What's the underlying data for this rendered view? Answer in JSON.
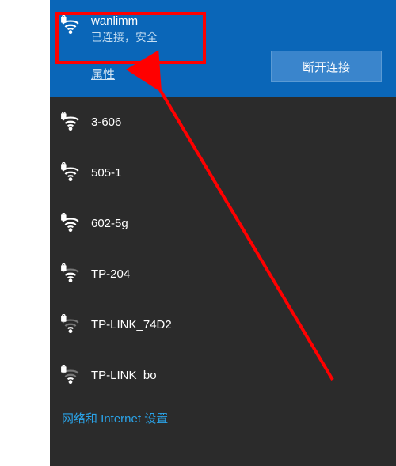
{
  "active": {
    "name": "wanlimm",
    "status": "已连接，安全",
    "properties_label": "属性",
    "disconnect_label": "断开连接"
  },
  "networks": [
    {
      "name": "3-606"
    },
    {
      "name": "505-1"
    },
    {
      "name": "602-5g"
    },
    {
      "name": "TP-204"
    },
    {
      "name": "TP-LINK_74D2"
    },
    {
      "name": "TP-LINK_bo"
    }
  ],
  "settings_label": "网络和 Internet 设置"
}
